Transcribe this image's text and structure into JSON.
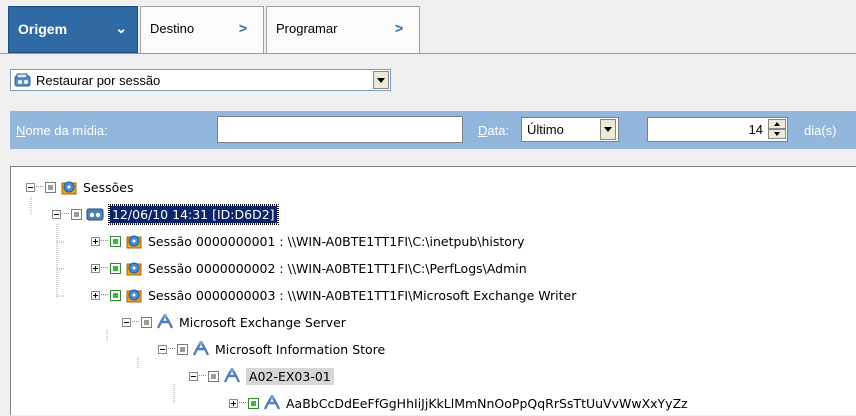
{
  "tabs": {
    "origem": "Origem",
    "destino": "Destino",
    "programar": "Programar"
  },
  "restore_mode": {
    "selected": "Restaurar por sessão"
  },
  "filters": {
    "media_label_prefix": "N",
    "media_label_rest": "ome da mídia:",
    "media_value": "",
    "date_label_prefix": "D",
    "date_label_rest": "ata:",
    "date_selected": "Último",
    "days_value": "14",
    "days_unit": "dia(s)"
  },
  "tree": {
    "root": "Sessões",
    "session": "12/06/10 14:31 [ID:D6D2]",
    "session1": "Sessão 0000000001 : \\\\WIN-A0BTE1TT1FI\\C:\\inetpub\\history",
    "session2": "Sessão 0000000002 : \\\\WIN-A0BTE1TT1FI\\C:\\PerfLogs\\Admin",
    "session3": "Sessão 0000000003 : \\\\WIN-A0BTE1TT1FI\\Microsoft Exchange Writer",
    "exchange_server": "Microsoft Exchange Server",
    "info_store": "Microsoft Information Store",
    "storage_group": "A02-EX03-01",
    "mailbox_db": "AaBbCcDdEeFfGgHhIiJjKkLlMmNnOoPpQqRrSsTtUuVvWwXxYyZz"
  },
  "colors": {
    "tab_active": "#2f6aa4",
    "filter_bar": "#93b7dc",
    "selection": "#0b246a"
  }
}
